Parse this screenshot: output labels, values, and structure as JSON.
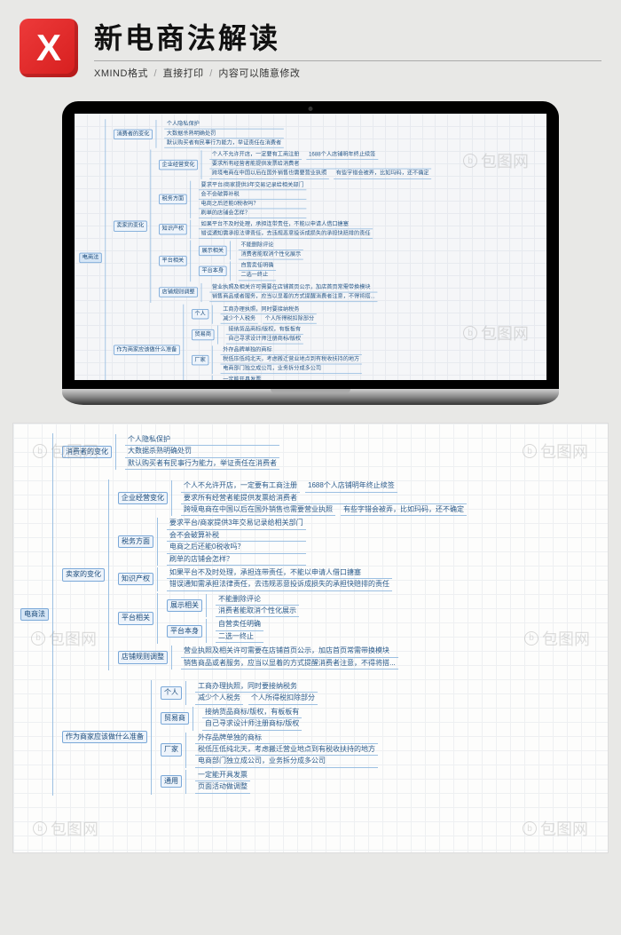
{
  "header": {
    "logo_letter": "X",
    "title": "新电商法解读",
    "subtitle_a": "XMIND格式",
    "subtitle_b": "直接打印",
    "subtitle_c": "内容可以随意修改"
  },
  "watermark": "包图网",
  "root": {
    "label": "电商法"
  },
  "branch1": {
    "label": "消费者的变化",
    "c1": "个人隐私保护",
    "c2": "大数据杀熟明确处罚",
    "c3": "默认购买者有民事行为能力，举证责任在消费者"
  },
  "branch2": {
    "label": "卖家的变化",
    "b2a": {
      "label": "企业经营变化",
      "c1": "个人不允许开店，一定要有工商注册",
      "c1b": "1688个人店铺明年终止续签",
      "c2": "要求所有经营者能提供发票给消费者",
      "c3": "跨境电商在中国以后在国外销售也需要营业执照",
      "c3b": "有些字错会被弄，比如玛码，还不确定"
    },
    "b2b": {
      "label": "税务方面",
      "c1": "要求平台/商家提供3年交易记录给相关部门",
      "c2": "会不会破算补税",
      "c3": "电商之后还能0税收吗？",
      "c4": "刷单的店铺会怎样？"
    },
    "b2c": {
      "label": "知识产权",
      "c1": "如果平台不及时处理，承担连带责任，不能以申请人借口搪塞",
      "c2": "错误通知需承担法律责任，去违规恶意投诉成损失的承担快赔排的责任"
    },
    "b2d": {
      "label": "平台相关",
      "d1": {
        "label": "展示相关",
        "c1": "不能删除评论",
        "c2": "消费者能取消个性化展示"
      },
      "d2": {
        "label": "平台本身",
        "c1": "自营卖任明确",
        "c2": "二选一终止"
      }
    },
    "b2e": {
      "label": "店铺规则调整",
      "c1": "营业执照及相关许可需要在店铺首页公示，加店首页常需带换模块",
      "c2": "销售商品或者服务，应当以显着的方式提醒消费者注意，不得将搭..."
    }
  },
  "branch3": {
    "label": "作为商家应该做什么准备",
    "b3a": {
      "label": "个人",
      "c1": "工商办理执照，同时要接纳税务",
      "c2a": "减少个人税务",
      "c2b": "个人所得税扣除部分"
    },
    "b3b": {
      "label": "贸易商",
      "c1": "接纳货品商标/版权，有板板有",
      "c2": "自己寻求设计师注册商标/版权"
    },
    "b3c": {
      "label": "厂家",
      "c1": "外存品牌单独的商标",
      "c2": "税低压低纯北天，考虑搬迁营业地点到有税收扶持的地方",
      "c3": "电商部门独立成公司，业务拆分成多公司"
    },
    "b3d": {
      "label": "通用",
      "c1": "一定能开具发票",
      "c2": "页面活动做调整"
    }
  }
}
